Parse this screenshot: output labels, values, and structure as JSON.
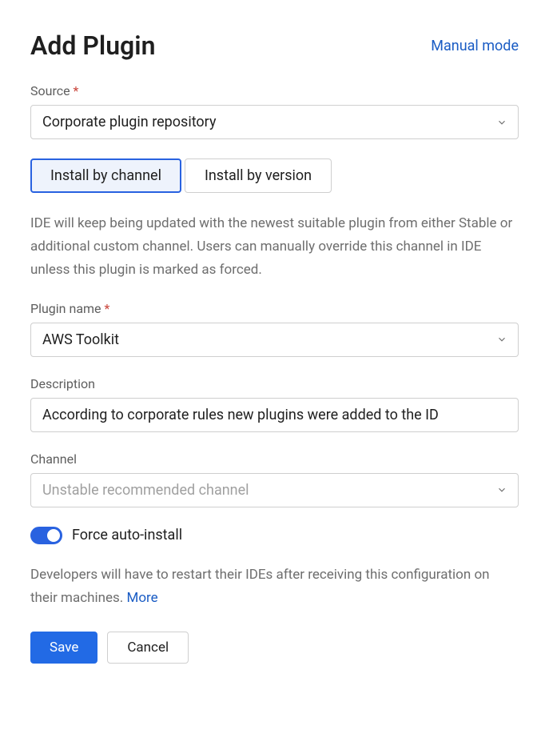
{
  "header": {
    "title": "Add Plugin",
    "manual_mode_link": "Manual mode"
  },
  "source": {
    "label": "Source",
    "value": "Corporate plugin repository"
  },
  "tabs": {
    "install_by_channel": "Install by channel",
    "install_by_version": "Install by version"
  },
  "channel_help_text": "IDE will keep being updated with the newest suitable plugin from either Stable or additional custom channel. Users can manually override this channel in IDE unless this plugin is marked as forced.",
  "plugin_name": {
    "label": "Plugin name",
    "value": "AWS Toolkit"
  },
  "description": {
    "label": "Description",
    "value": "According to corporate rules new plugins were added to the ID"
  },
  "channel": {
    "label": "Channel",
    "placeholder": "Unstable recommended channel"
  },
  "force_auto_install": {
    "label": "Force auto-install"
  },
  "restart_text": "Developers will have to restart their IDEs after receiving this configuration on their machines. ",
  "more_link": "More",
  "buttons": {
    "save": "Save",
    "cancel": "Cancel"
  }
}
